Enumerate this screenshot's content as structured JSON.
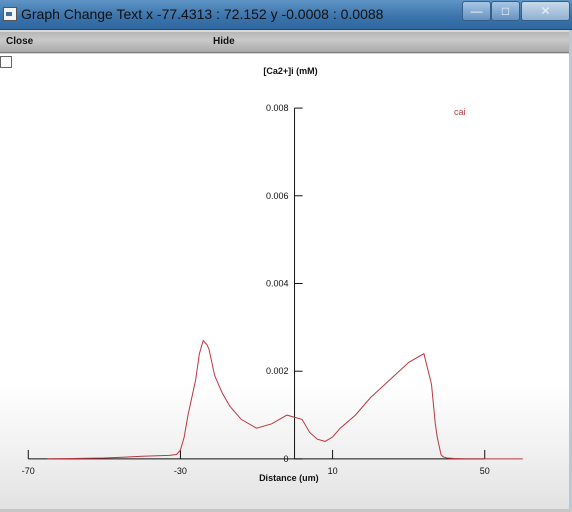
{
  "window": {
    "title": "Graph Change Text x -77.4313 : 72.152  y -0.0008 : 0.0088",
    "minimize_glyph": "—",
    "maximize_glyph": "□",
    "close_glyph": "✕"
  },
  "menu": {
    "close_label": "Close",
    "hide_label": "Hide"
  },
  "colors": {
    "series": "#b8383f",
    "axis": "#111111",
    "titlebar": "#3c75ad"
  },
  "chart_data": {
    "type": "line",
    "title": "[Ca2+]i (mM)",
    "xlabel": "Distance (um)",
    "ylabel": "[Ca2+]i (mM)",
    "xlim": [
      -77.4313,
      72.152
    ],
    "ylim": [
      -0.0008,
      0.0088
    ],
    "xticks": [
      -70,
      -30,
      10,
      50
    ],
    "xtick_labels": [
      "-70",
      "-30",
      "10",
      "50"
    ],
    "yticks": [
      0,
      0.002,
      0.004,
      0.006,
      0.008
    ],
    "ytick_labels": [
      "0",
      "0.002",
      "0.004",
      "0.006",
      "0.008"
    ],
    "grid": false,
    "legend_position": "top-right",
    "series": [
      {
        "name": "cai",
        "x": [
          -65,
          -50,
          -40,
          -33,
          -31,
          -30,
          -29,
          -28,
          -26,
          -25,
          -24,
          -23,
          -22.5,
          -22,
          -21.5,
          -21,
          -20,
          -19,
          -17,
          -14,
          -10,
          -6,
          -2,
          2,
          4,
          6,
          8,
          10,
          12,
          16,
          20,
          25,
          30,
          34,
          36,
          37,
          37.5,
          38,
          38.5,
          39,
          40,
          42,
          45,
          50,
          60
        ],
        "y": [
          0.0,
          2e-05,
          6e-05,
          8e-05,
          0.0001,
          0.0002,
          0.0005,
          0.001,
          0.0018,
          0.0024,
          0.0027,
          0.0026,
          0.0025,
          0.0023,
          0.0021,
          0.0019,
          0.0017,
          0.0015,
          0.0012,
          0.0009,
          0.0007,
          0.0008,
          0.001,
          0.0009,
          0.0006,
          0.00045,
          0.0004,
          0.0005,
          0.0007,
          0.001,
          0.0014,
          0.0018,
          0.0022,
          0.0024,
          0.0017,
          0.0008,
          0.0005,
          0.0003,
          0.0001,
          5e-05,
          2e-05,
          1e-05,
          0.0,
          0.0,
          0.0
        ]
      }
    ]
  }
}
